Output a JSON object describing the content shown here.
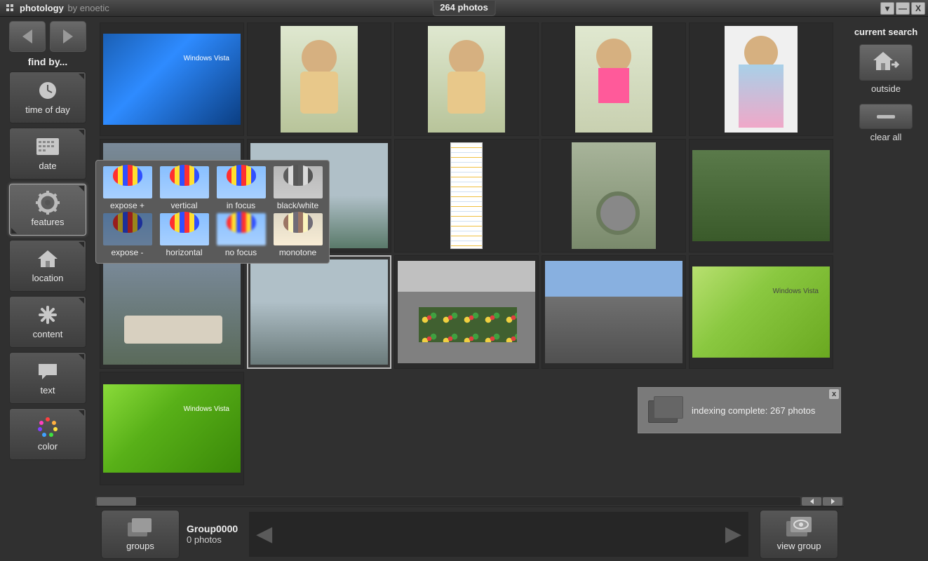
{
  "app": {
    "title": "photology",
    "subtitle": "by enoetic",
    "photo_count": "264 photos"
  },
  "sidebar": {
    "findby_label": "find by...",
    "items": [
      {
        "id": "time-of-day",
        "label": "time of day"
      },
      {
        "id": "date",
        "label": "date"
      },
      {
        "id": "features",
        "label": "features"
      },
      {
        "id": "location",
        "label": "location"
      },
      {
        "id": "content",
        "label": "content"
      },
      {
        "id": "text",
        "label": "text"
      },
      {
        "id": "color",
        "label": "color"
      }
    ]
  },
  "features_popup": {
    "row1": [
      {
        "label": "expose +"
      },
      {
        "label": "vertical"
      },
      {
        "label": "in focus"
      },
      {
        "label": "black/white"
      }
    ],
    "row2": [
      {
        "label": "expose -"
      },
      {
        "label": "horizontal"
      },
      {
        "label": "no focus"
      },
      {
        "label": "monotone"
      }
    ]
  },
  "rightpanel": {
    "title": "current search",
    "filter_label": "outside",
    "clear_label": "clear all"
  },
  "bottombar": {
    "groups_label": "groups",
    "group_title": "Group0000",
    "group_count": "0 photos",
    "view_group_label": "view group"
  },
  "toast": {
    "message": "indexing complete: 267 photos"
  }
}
